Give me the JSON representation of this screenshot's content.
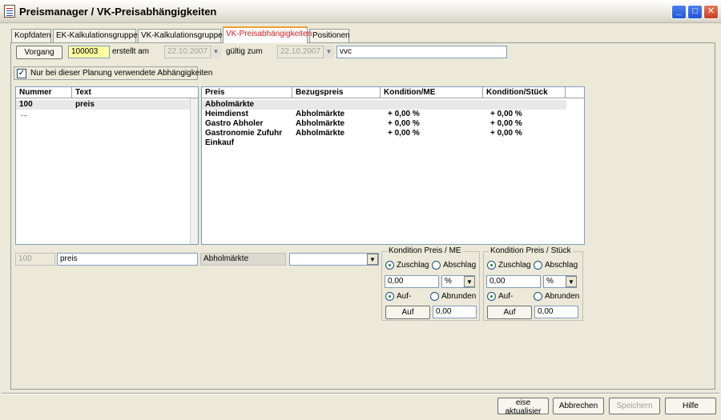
{
  "window": {
    "title": "Preismanager / VK-Preisabhängigkeiten"
  },
  "tabs": [
    {
      "label": "Kopfdaten"
    },
    {
      "label": "EK-Kalkulationsgruppen"
    },
    {
      "label": "VK-Kalkulationsgruppen"
    },
    {
      "label": "VK-Preisabhängigkeiten"
    },
    {
      "label": "Positionen"
    }
  ],
  "header": {
    "vorgang_button": "Vorgang",
    "vorgang_value": "100003",
    "erstellt_label": "erstellt am",
    "erstellt_value": "22.10.2007",
    "gueltig_label": "gültig zum",
    "gueltig_value": "22.10.2007",
    "description_value": "vvc"
  },
  "filter_checkbox": {
    "label": "Nur bei dieser Planung verwendete Abhängigkeiten",
    "checked": true
  },
  "left_list": {
    "columns": [
      "Nummer",
      "Text"
    ],
    "rows": [
      {
        "nummer": "100",
        "text": "preis"
      },
      {
        "nummer": "...",
        "text": ""
      }
    ]
  },
  "right_list": {
    "columns": [
      "Preis",
      "Bezugspreis",
      "Kondition/ME",
      "Kondition/Stück"
    ],
    "rows": [
      {
        "preis": "Abholmärkte",
        "bezug": "",
        "kme": "",
        "kstueck": ""
      },
      {
        "preis": "Heimdienst",
        "bezug": "Abholmärkte",
        "kme": "+ 0,00 %",
        "kstueck": "+ 0,00 %"
      },
      {
        "preis": "Gastro Abholer",
        "bezug": "Abholmärkte",
        "kme": "+ 0,00 %",
        "kstueck": "+ 0,00 %"
      },
      {
        "preis": "Gastronomie Zufuhr",
        "bezug": "Abholmärkte",
        "kme": "+ 0,00 %",
        "kstueck": "+ 0,00 %"
      },
      {
        "preis": "Einkauf",
        "bezug": "",
        "kme": "",
        "kstueck": ""
      }
    ]
  },
  "detail": {
    "nummer": "100",
    "text": "preis",
    "bezug": "Abholmärkte",
    "combo_value": ""
  },
  "kondition_me": {
    "title": "Kondition Preis / ME",
    "zuschlag": "Zuschlag",
    "abschlag": "Abschlag",
    "value": "0,00",
    "unit": "%",
    "auf": "Auf-",
    "abrunden": "Abrunden",
    "auf_button": "Auf",
    "auf_value": "0,00"
  },
  "kondition_stueck": {
    "title": "Kondition Preis / Stück",
    "zuschlag": "Zuschlag",
    "abschlag": "Abschlag",
    "value": "0,00",
    "unit": "%",
    "auf": "Auf-",
    "abrunden": "Abrunden",
    "auf_button": "Auf",
    "auf_value": "0,00"
  },
  "footer": {
    "update": "eise aktualisier",
    "cancel": "Abbrechen",
    "save": "Speichern",
    "help": "Hilfe"
  },
  "colors": {
    "active_tab_text": "#e02020",
    "yellow_field": "#ffffa0",
    "titlebar_close": "#c8401c"
  }
}
